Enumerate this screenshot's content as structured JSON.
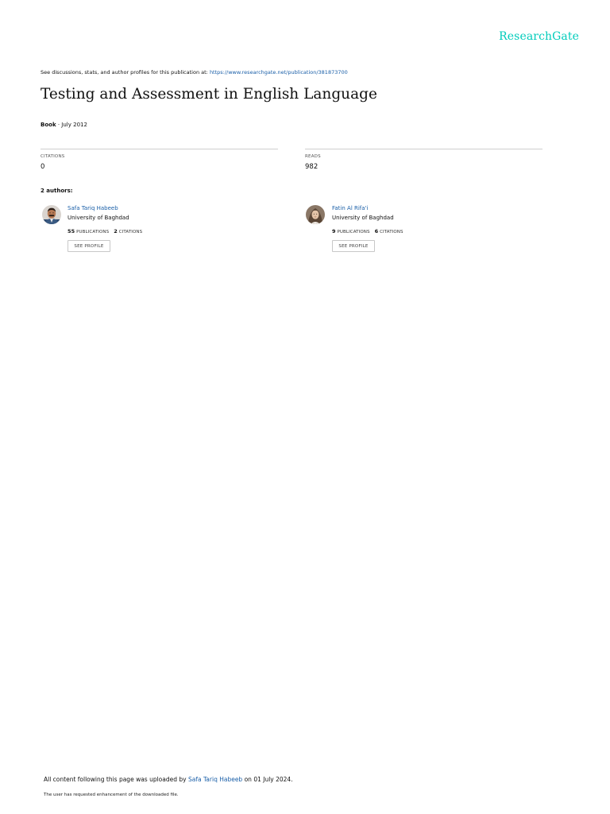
{
  "brand": {
    "name": "ResearchGate",
    "color": "#00ccbb"
  },
  "header": {
    "discuss_text": "See discussions, stats, and author profiles for this publication at: ",
    "publication_url": "https://www.researchgate.net/publication/381873700"
  },
  "publication": {
    "title": "Testing and Assessment in English Language",
    "type": "Book",
    "date_sep": " · ",
    "date": "July 2012"
  },
  "stats": {
    "citations_label": "CITATIONS",
    "citations_value": "0",
    "reads_label": "READS",
    "reads_value": "982"
  },
  "authors_label": "2 authors:",
  "authors": [
    {
      "name": "Safa Tariq Habeeb",
      "institution": "University of Baghdad",
      "publications_count": "55",
      "publications_label": "PUBLICATIONS",
      "citations_count": "2",
      "citations_label": "CITATIONS",
      "button_label": "SEE PROFILE",
      "avatar_icon": "male-author-photo-icon"
    },
    {
      "name": "Fatin Al Rifa'i",
      "institution": "University of Baghdad",
      "publications_count": "9",
      "publications_label": "PUBLICATIONS",
      "citations_count": "6",
      "citations_label": "CITATIONS",
      "button_label": "SEE PROFILE",
      "avatar_icon": "female-author-photo-icon"
    }
  ],
  "footer": {
    "uploaded_prefix": "All content following this page was uploaded by ",
    "uploader_name": "Safa Tariq Habeeb",
    "uploaded_suffix": " on 01 July 2024.",
    "enhancement_note": "The user has requested enhancement of the downloaded file."
  },
  "colors": {
    "link": "#1a5fa8",
    "rule": "#cfcfcf"
  }
}
